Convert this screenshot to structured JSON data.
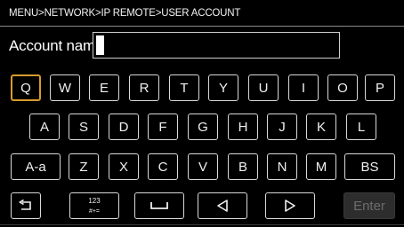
{
  "breadcrumb": "MENU>NETWORK>IP REMOTE>USER ACCOUNT",
  "account_label": "Account name",
  "account_value": "",
  "row1": [
    "Q",
    "W",
    "E",
    "R",
    "T",
    "Y",
    "U",
    "I",
    "O",
    "P"
  ],
  "row2": [
    "A",
    "S",
    "D",
    "F",
    "G",
    "H",
    "J",
    "K",
    "L"
  ],
  "row3": [
    "A-a",
    "Z",
    "X",
    "C",
    "V",
    "B",
    "N",
    "M",
    "BS"
  ],
  "row4": {
    "back_icon": "return-arrow-icon",
    "numsym_top": "123",
    "numsym_bottom": "#+=",
    "space_icon": "space-bar-icon",
    "left_icon": "left-triangle-icon",
    "right_icon": "right-triangle-icon",
    "enter": "Enter"
  },
  "colors": {
    "selection": "#d79a2e",
    "disabled_bg": "#2d2d2d"
  }
}
